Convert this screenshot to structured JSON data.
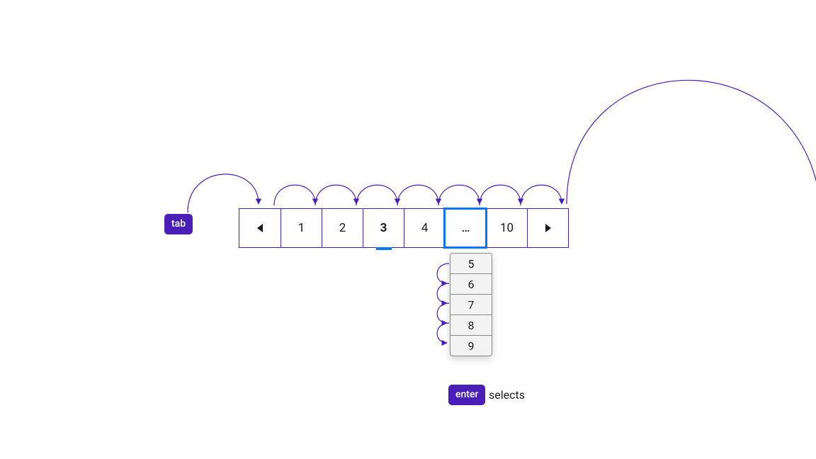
{
  "keys": {
    "tab_label": "tab",
    "enter_label": "enter",
    "enter_action": "selects"
  },
  "pagination": {
    "prev_icon": "triangle-left",
    "next_icon": "triangle-right",
    "items": [
      {
        "label": "1",
        "current": false,
        "focused": false
      },
      {
        "label": "2",
        "current": false,
        "focused": false
      },
      {
        "label": "3",
        "current": true,
        "focused": false
      },
      {
        "label": "4",
        "current": false,
        "focused": false
      },
      {
        "label": "…",
        "current": false,
        "focused": true
      },
      {
        "label": "10",
        "current": false,
        "focused": false
      }
    ],
    "overflow_options": [
      {
        "label": "5"
      },
      {
        "label": "6"
      },
      {
        "label": "7"
      },
      {
        "label": "8"
      },
      {
        "label": "9"
      }
    ]
  },
  "colors": {
    "accent": "#4a1fb8",
    "focus": "#0b74ff"
  }
}
